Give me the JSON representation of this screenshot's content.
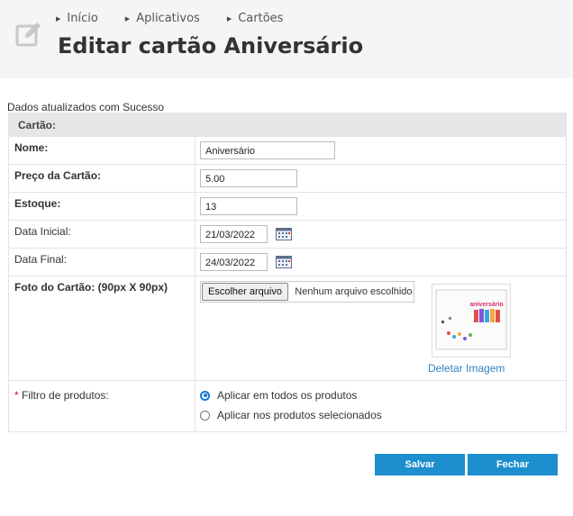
{
  "breadcrumb": [
    "Início",
    "Aplicativos",
    "Cartões"
  ],
  "page_title": "Editar cartão Aniversário",
  "status_message": "Dados atualizados com Sucesso",
  "form": {
    "section_title": "Cartão:",
    "nome_label": "Nome:",
    "nome_value": "Aniversário",
    "preco_label": "Preço da Cartão:",
    "preco_value": "5.00",
    "estoque_label": "Estoque:",
    "estoque_value": "13",
    "data_inicial_label": "Data Inicial:",
    "data_inicial_value": "21/03/2022",
    "data_final_label": "Data Final:",
    "data_final_value": "24/03/2022",
    "foto_label": "Foto do Cartão: (90px X 90px)",
    "file_button": "Escolher arquivo",
    "file_status": "Nenhum arquivo escolhido",
    "thumbnail_text": "aniversário",
    "delete_image": "Deletar Imagem",
    "filtro_required_mark": "*",
    "filtro_label": "Filtro de produtos:",
    "filtro_options": [
      "Aplicar em todos os produtos",
      "Aplicar nos produtos selecionados"
    ],
    "filtro_selected": 0
  },
  "buttons": {
    "save": "Salvar",
    "close": "Fechar"
  },
  "colors": {
    "accent": "#1e8fce",
    "link": "#2f82c5",
    "header_bg": "#f5f5f5",
    "section_bg": "#e6e6e6"
  },
  "icons": {
    "header": "edit-icon",
    "calendar": "calendar-icon",
    "breadcrumb_caret": "caret-right-icon"
  }
}
